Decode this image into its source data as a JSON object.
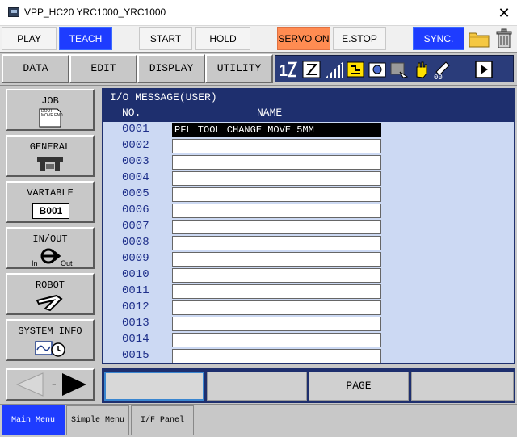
{
  "window": {
    "title": "VPP_HC20 YRC1000_YRC1000"
  },
  "topbar": {
    "play": "PLAY",
    "teach": "TEACH",
    "start": "START",
    "hold": "HOLD",
    "servo_on": "SERVO ON",
    "estop": "E.STOP",
    "sync": "SYNC."
  },
  "menubar": {
    "data": "DATA",
    "edit": "EDIT",
    "display": "DISPLAY",
    "utility": "UTILITY"
  },
  "leftmenu": {
    "job": "JOB",
    "job_icon_text": "DOUT MOVE END",
    "general": "GENERAL",
    "variable": "VARIABLE",
    "variable_value": "B001",
    "inout": "IN/OUT",
    "in_label": "In",
    "out_label": "Out",
    "robot": "ROBOT",
    "system_info": "SYSTEM INFO"
  },
  "main": {
    "header_title": "I/O MESSAGE(USER)",
    "col_no": "NO.",
    "col_name": "NAME",
    "rows": [
      {
        "no": "0001",
        "name": "PFL TOOL CHANGE MOVE 5MM"
      },
      {
        "no": "0002",
        "name": ""
      },
      {
        "no": "0003",
        "name": ""
      },
      {
        "no": "0004",
        "name": ""
      },
      {
        "no": "0005",
        "name": ""
      },
      {
        "no": "0006",
        "name": ""
      },
      {
        "no": "0007",
        "name": ""
      },
      {
        "no": "0008",
        "name": ""
      },
      {
        "no": "0009",
        "name": ""
      },
      {
        "no": "0010",
        "name": ""
      },
      {
        "no": "0011",
        "name": ""
      },
      {
        "no": "0012",
        "name": ""
      },
      {
        "no": "0013",
        "name": ""
      },
      {
        "no": "0014",
        "name": ""
      },
      {
        "no": "0015",
        "name": ""
      }
    ]
  },
  "fkeys": {
    "f1": "",
    "f2": "",
    "f3": "PAGE",
    "f4": ""
  },
  "bottombar": {
    "main_menu": "Main Menu",
    "simple_menu": "Simple Menu",
    "if_panel": "I/F Panel"
  },
  "colors": {
    "teach_active": "#1e3cff",
    "servo_on": "#ff8c52",
    "panel_navy": "#1e2f6e",
    "list_bg": "#ccd9f3"
  }
}
